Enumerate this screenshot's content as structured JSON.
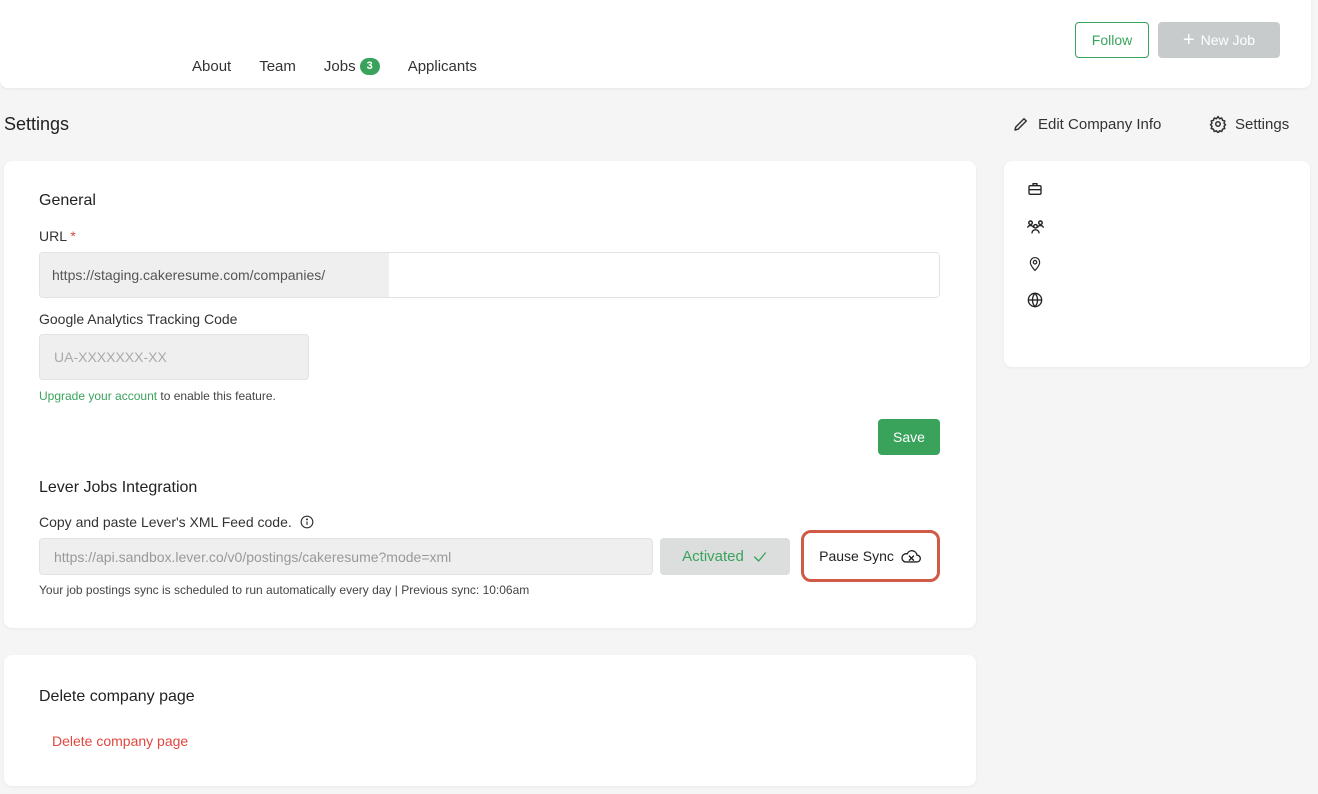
{
  "header": {
    "nav": [
      {
        "label": "About"
      },
      {
        "label": "Team"
      },
      {
        "label": "Jobs",
        "badge": "3"
      },
      {
        "label": "Applicants"
      }
    ],
    "follow_label": "Follow",
    "new_job_label": "New Job"
  },
  "page": {
    "title": "Settings",
    "edit_company_label": "Edit Company Info",
    "settings_label": "Settings"
  },
  "general": {
    "title": "General",
    "url_label": "URL",
    "url_required": "*",
    "url_prefix": "https://staging.cakeresume.com/companies/",
    "url_value": "",
    "ga_label": "Google Analytics Tracking Code",
    "ga_placeholder": "UA-XXXXXXX-XX",
    "upgrade_link": "Upgrade your account",
    "upgrade_rest": " to enable this feature.",
    "save_label": "Save"
  },
  "lever": {
    "title": "Lever Jobs Integration",
    "instruction": "Copy and paste Lever's XML Feed code.",
    "feed_value": "https://api.sandbox.lever.co/v0/postings/cakeresume?mode=xml",
    "activated_label": "Activated",
    "pause_label": "Pause Sync",
    "sync_note": "Your job postings sync is scheduled to run automatically every day | Previous sync: 10:06am"
  },
  "delete_section": {
    "title": "Delete company page",
    "link_label": "Delete company page"
  },
  "sidebar": {
    "icons": [
      "briefcase-icon",
      "team-icon",
      "location-pin-icon",
      "globe-icon"
    ]
  },
  "colors": {
    "accent": "#3aa35b",
    "danger": "#e0473f",
    "highlight": "#d05a48"
  }
}
